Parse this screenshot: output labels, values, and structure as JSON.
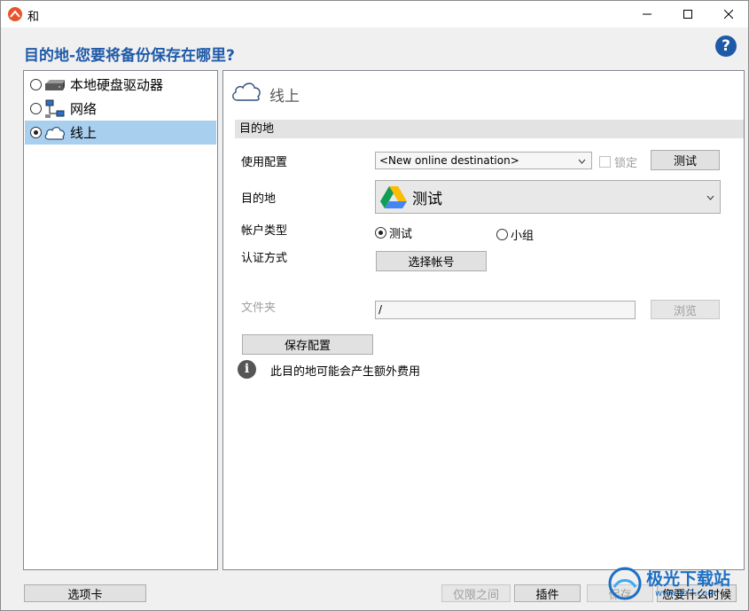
{
  "window": {
    "title": "和",
    "heading": "目的地-您要将备份保存在哪里?",
    "help_icon_text": "?"
  },
  "destinations": [
    {
      "label": "本地硬盘驱动器",
      "icon": "hard-drive-icon",
      "checked": false
    },
    {
      "label": "网络",
      "icon": "network-icon",
      "checked": false
    },
    {
      "label": "线上",
      "icon": "cloud-icon",
      "checked": true
    }
  ],
  "panel": {
    "title": "线上",
    "section": "目的地",
    "config_label": "使用配置",
    "config_value": "<New online destination>",
    "lock_label": "锁定",
    "test_button": "测试",
    "destination_label": "目的地",
    "destination_value": "测试",
    "account_type_label": "帐户类型",
    "account_options": [
      "测试",
      "小组"
    ],
    "auth_label": "认证方式",
    "choose_account_button": "选择帐号",
    "folder_label": "文件夹",
    "folder_value": "/",
    "browse_button": "浏览",
    "save_config_button": "保存配置",
    "info_icon_text": "i",
    "info_text": "此目的地可能会产生额外费用"
  },
  "footer": {
    "tabs_button": "选项卡",
    "prev_button": "仅限之间",
    "plugins_button": "插件",
    "save_button": "保存",
    "when_button": "您要什么时候"
  },
  "watermark": {
    "text": "极光下载站",
    "url": "www.xz7.com"
  },
  "colors": {
    "heading": "#1f5aa8",
    "selection": "#a9cfef",
    "app_logo": "#e8532b"
  }
}
